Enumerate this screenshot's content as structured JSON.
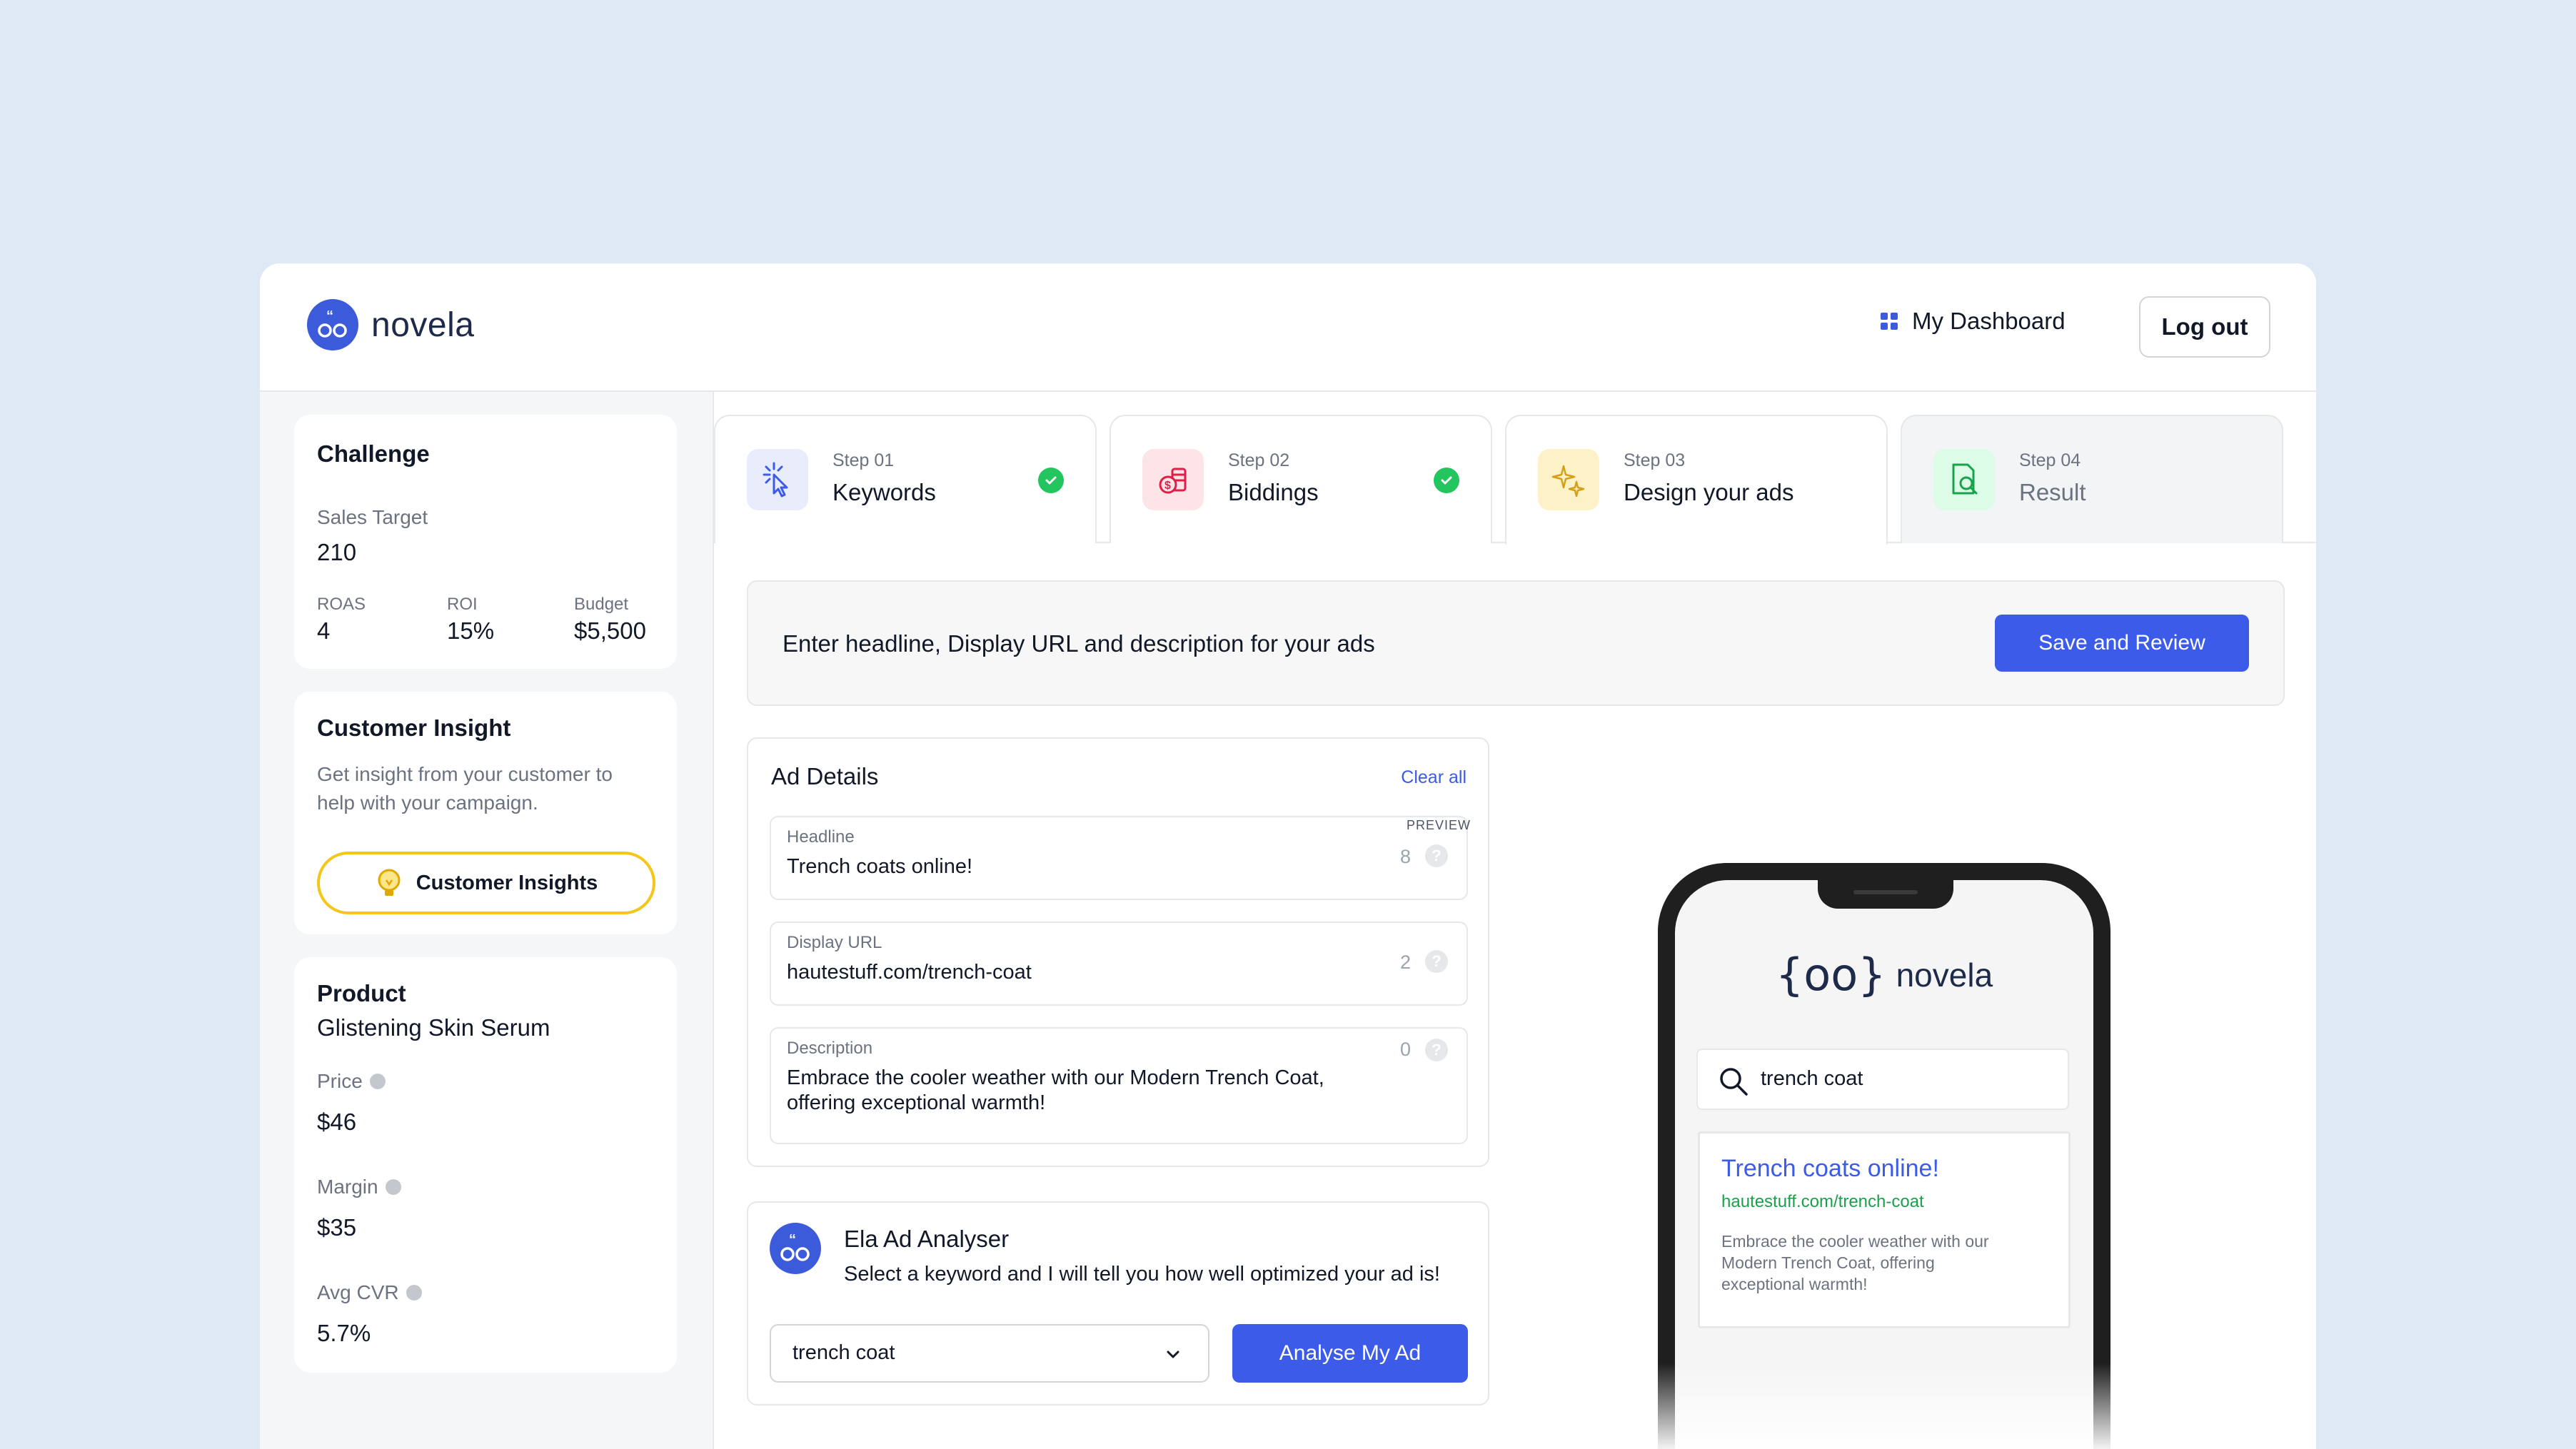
{
  "app": {
    "name": "novela"
  },
  "header": {
    "dashboard_label": "My Dashboard",
    "logout_label": "Log out"
  },
  "sidebar": {
    "challenge": {
      "title": "Challenge",
      "sales_target_label": "Sales Target",
      "sales_target_value": "210",
      "roas_label": "ROAS",
      "roas_value": "4",
      "roi_label": "ROI",
      "roi_value": "15%",
      "budget_label": "Budget",
      "budget_value": "$5,500"
    },
    "insight": {
      "title": "Customer Insight",
      "description_line1": "Get insight from your customer to",
      "description_line2": "help with your campaign.",
      "button_label": "Customer Insights"
    },
    "product": {
      "title": "Product",
      "name": "Glistening Skin Serum",
      "price_label": "Price",
      "price_value": "$46",
      "margin_label": "Margin",
      "margin_value": "$35",
      "cvr_label": "Avg CVR",
      "cvr_value": "5.7%"
    }
  },
  "steps": [
    {
      "step": "Step 01",
      "name": "Keywords",
      "done": true
    },
    {
      "step": "Step 02",
      "name": "Biddings",
      "done": true
    },
    {
      "step": "Step 03",
      "name": "Design your ads",
      "done": false
    },
    {
      "step": "Step 04",
      "name": "Result",
      "done": false
    }
  ],
  "instruction": {
    "text": "Enter headline, Display URL and description for your ads",
    "button_label": "Save and Review"
  },
  "ad_details": {
    "title": "Ad Details",
    "clear_label": "Clear all",
    "headline": {
      "label": "Headline",
      "value": "Trench coats online!",
      "count": "8"
    },
    "display_url": {
      "label": "Display URL",
      "value": "hautestuff.com/trench-coat",
      "count": "2"
    },
    "description": {
      "label": "Description",
      "value_line1": "Embrace the cooler weather with our Modern Trench Coat,",
      "value_line2": "offering exceptional warmth!",
      "count": "0"
    },
    "help_glyph": "?"
  },
  "ela": {
    "title": "Ela Ad Analyser",
    "subtitle": "Select a keyword and I will tell you how well optimized your ad is!",
    "selected_keyword": "trench coat",
    "button_label": "Analyse My Ad"
  },
  "preview": {
    "label": "PREVIEW",
    "brand_mark": "{oo}",
    "brand_name": "novela",
    "search_query": "trench coat",
    "result_title": "Trench coats online!",
    "result_url": "hautestuff.com/trench-coat",
    "result_desc_line1": "Embrace the cooler weather with our",
    "result_desc_line2": "Modern Trench Coat, offering",
    "result_desc_line3": "exceptional warmth!"
  },
  "colors": {
    "accent": "#3b5be8",
    "success": "#22c55e",
    "insight_border": "#f5c518",
    "preview_link": "#3b5be8",
    "preview_url": "#16a34a"
  }
}
